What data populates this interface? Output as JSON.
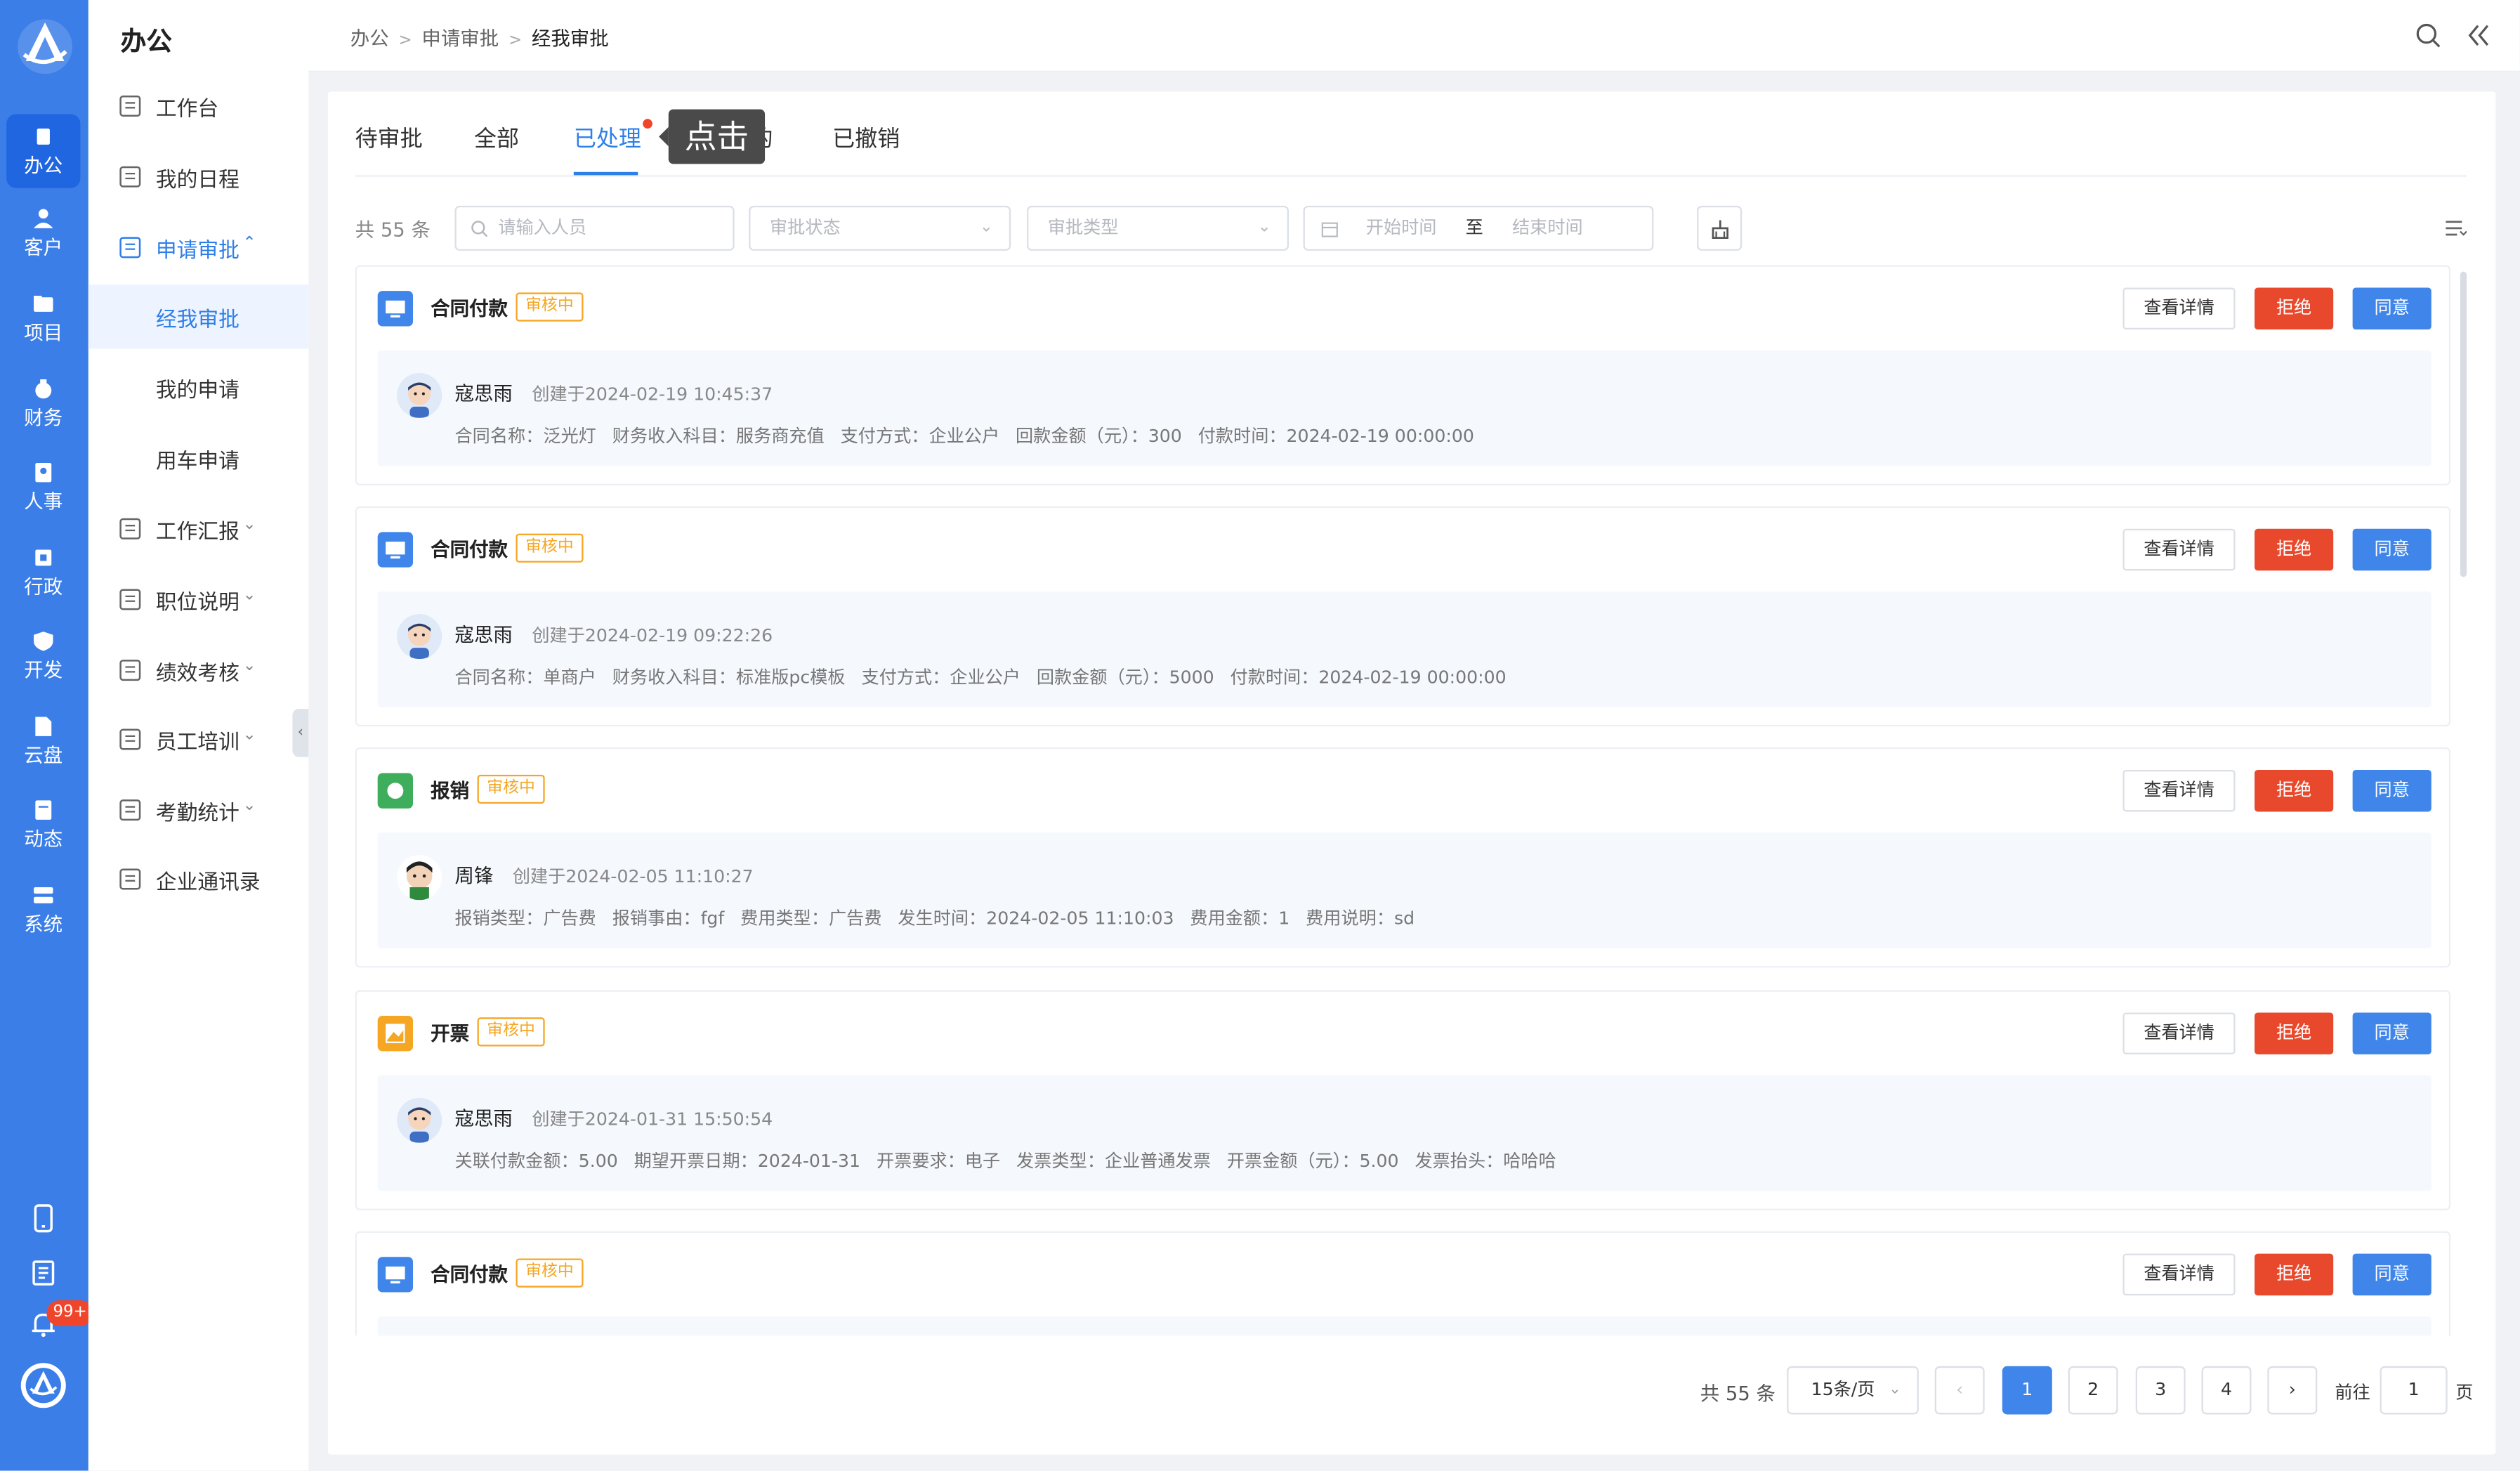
{
  "nav_rail": {
    "items": [
      {
        "label": "办公",
        "icon": "office-icon",
        "active": true
      },
      {
        "label": "客户",
        "icon": "customer-icon"
      },
      {
        "label": "项目",
        "icon": "project-icon"
      },
      {
        "label": "财务",
        "icon": "finance-icon"
      },
      {
        "label": "人事",
        "icon": "hr-icon"
      },
      {
        "label": "行政",
        "icon": "admin-icon"
      },
      {
        "label": "开发",
        "icon": "dev-icon"
      },
      {
        "label": "云盘",
        "icon": "cloud-icon"
      },
      {
        "label": "动态",
        "icon": "feed-icon"
      },
      {
        "label": "系统",
        "icon": "system-icon"
      }
    ],
    "notification_badge": "99+"
  },
  "sidebar": {
    "title": "办公",
    "items": [
      {
        "label": "工作台"
      },
      {
        "label": "我的日程"
      },
      {
        "label": "申请审批"
      },
      {
        "label": "经我审批"
      },
      {
        "label": "我的申请"
      },
      {
        "label": "用车申请"
      },
      {
        "label": "工作汇报"
      },
      {
        "label": "职位说明"
      },
      {
        "label": "绩效考核"
      },
      {
        "label": "员工培训"
      },
      {
        "label": "考勤统计"
      },
      {
        "label": "企业通讯录"
      }
    ]
  },
  "breadcrumb": [
    "办公",
    "申请审批",
    "经我审批"
  ],
  "tabs": [
    "待审批",
    "全部",
    "已处理",
    "",
    "已撤销"
  ],
  "tooltip": "点击",
  "tab_partial": "的",
  "filters": {
    "total": "共 55 条",
    "search_placeholder": "请输入人员",
    "status_placeholder": "审批状态",
    "type_placeholder": "审批类型",
    "start_placeholder": "开始时间",
    "to": "至",
    "end_placeholder": "结束时间"
  },
  "buttons": {
    "detail": "查看详情",
    "reject": "拒绝",
    "agree": "同意"
  },
  "status_label": "审核中",
  "records": [
    {
      "title": "合同付款",
      "icon_color": "#3f85ea",
      "user": "寇思雨",
      "created": "创建于2024-02-19 10:45:37",
      "fields": [
        "合同名称：泛光灯",
        "财务收入科目：服务商充值",
        "支付方式：企业公户",
        "回款金额（元）：300",
        "付款时间：2024-02-19 00:00:00"
      ]
    },
    {
      "title": "合同付款",
      "icon_color": "#3f85ea",
      "user": "寇思雨",
      "created": "创建于2024-02-19 09:22:26",
      "fields": [
        "合同名称：单商户",
        "财务收入科目：标准版pc模板",
        "支付方式：企业公户",
        "回款金额（元）：5000",
        "付款时间：2024-02-19 00:00:00"
      ]
    },
    {
      "title": "报销",
      "icon_color": "#3fae5c",
      "user": "周锋",
      "created": "创建于2024-02-05 11:10:27",
      "fields": [
        "报销类型：广告费",
        "报销事由：fgf",
        "费用类型：广告费",
        "发生时间：2024-02-05 11:10:03",
        "费用金额：1",
        "费用说明：sd"
      ]
    },
    {
      "title": "开票",
      "icon_color": "#f5a623",
      "user": "寇思雨",
      "created": "创建于2024-01-31 15:50:54",
      "fields": [
        "关联付款金额：5.00",
        "期望开票日期：2024-01-31",
        "开票要求：电子",
        "发票类型：企业普通发票",
        "开票金额（元）：5.00",
        "发票抬头：哈哈哈"
      ]
    },
    {
      "title": "合同付款",
      "icon_color": "#3f85ea",
      "user": "",
      "created": "",
      "fields": []
    }
  ],
  "pagination": {
    "total": "共 55 条",
    "page_size": "15条/页",
    "pages": [
      "1",
      "2",
      "3",
      "4"
    ],
    "current": "1",
    "goto_label": "前往",
    "goto_value": "1",
    "goto_suffix": "页"
  }
}
